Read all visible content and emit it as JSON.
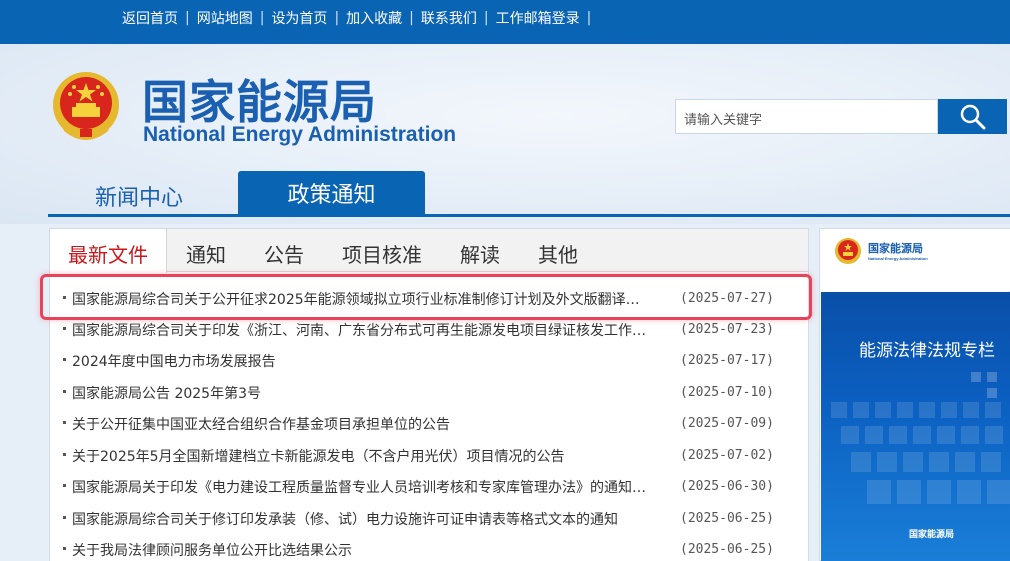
{
  "top_links": [
    "返回首页",
    "网站地图",
    "设为首页",
    "加入收藏",
    "联系我们",
    "工作邮箱登录"
  ],
  "logo": {
    "cn": "国家能源局",
    "en": "National Energy Administration"
  },
  "search": {
    "placeholder": "请输入关键字"
  },
  "nav": {
    "news": "新闻中心",
    "policy": "政策通知"
  },
  "tabs": [
    "最新文件",
    "通知",
    "公告",
    "项目核准",
    "解读",
    "其他"
  ],
  "list": [
    {
      "title": "国家能源局综合司关于公开征求2025年能源领域拟立项行业标准制修订计划及外文版翻译计…",
      "date": "(2025-07-27)"
    },
    {
      "title": "国家能源局综合司关于印发《浙江、河南、广东省分布式可再生能源发电项目绿证核发工作…",
      "date": "(2025-07-23)"
    },
    {
      "title": "2024年度中国电力市场发展报告",
      "date": "(2025-07-17)"
    },
    {
      "title": "国家能源局公告 2025年第3号",
      "date": "(2025-07-10)"
    },
    {
      "title": "关于公开征集中国亚太经合组织合作基金项目承担单位的公告",
      "date": "(2025-07-09)"
    },
    {
      "title": "关于2025年5月全国新增建档立卡新能源发电（不含户用光伏）项目情况的公告",
      "date": "(2025-07-02)"
    },
    {
      "title": "国家能源局关于印发《电力建设工程质量监督专业人员培训考核和专家库管理办法》的通知…",
      "date": "(2025-06-30)"
    },
    {
      "title": "国家能源局综合司关于修订印发承装（修、试）电力设施许可证申请表等格式文本的通知",
      "date": "(2025-06-25)"
    },
    {
      "title": "关于我局法律顾问服务单位公开比选结果公示",
      "date": "(2025-06-25)"
    }
  ],
  "side": {
    "cn": "国家能源局",
    "en": "National Energy Administration",
    "title": "能源法律法规专栏",
    "foot": "国家能源局"
  },
  "colors": {
    "primary": "#0a64b4",
    "active_tab": "#c8171d",
    "highlight": "#e8435a"
  },
  "icons": {
    "search": "search-icon",
    "emblem": "national-emblem-icon"
  }
}
